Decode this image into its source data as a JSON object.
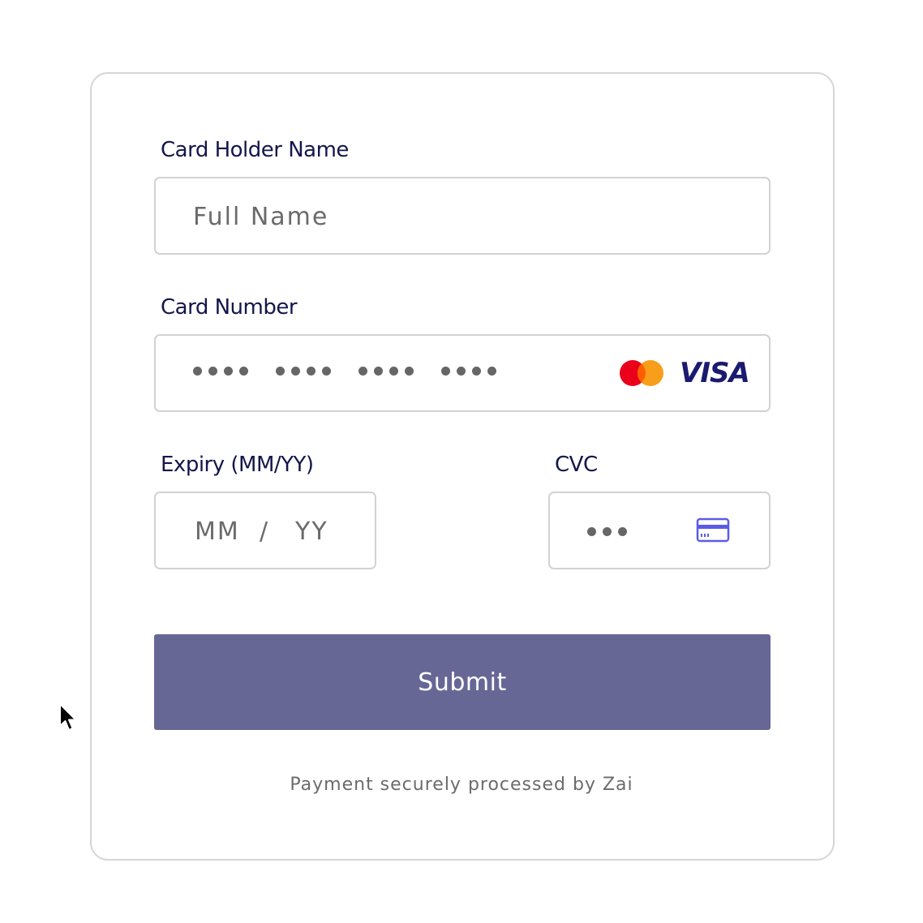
{
  "form": {
    "holder": {
      "label": "Card Holder Name",
      "placeholder": "Full Name"
    },
    "number": {
      "label": "Card Number",
      "brand_visa": "VISA"
    },
    "expiry": {
      "label": "Expiry (MM/YY)",
      "mm": "MM",
      "sep": "/",
      "yy": "YY"
    },
    "cvc": {
      "label": "CVC"
    },
    "submit_label": "Submit",
    "footer": "Payment securely processed by Zai"
  },
  "icons": {
    "mastercard": "mastercard-logo",
    "visa": "visa-logo",
    "cvc": "card-icon",
    "cursor": "mouse-cursor"
  },
  "colors": {
    "label": "#14164b",
    "button": "#676796",
    "visa": "#1a1b6e",
    "mastercard_red": "#eb001b",
    "mastercard_orange": "#f79e1b",
    "cvc_icon": "#5b5ce6"
  }
}
